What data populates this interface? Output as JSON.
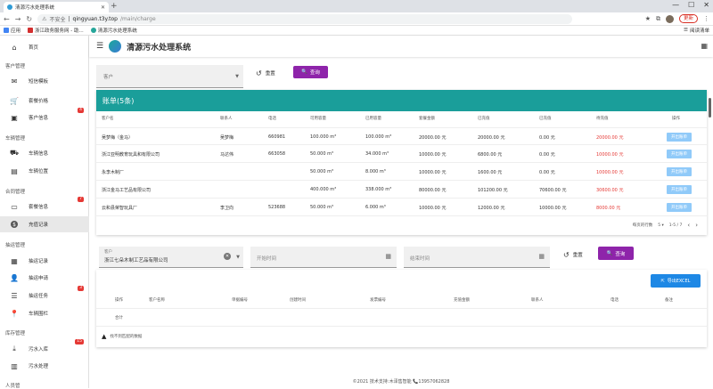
{
  "browser": {
    "tab_title": "清源污水处理系统",
    "url_warning": "不安全",
    "url_host": "qingyuan.t3y.top",
    "url_path": "/main/charge",
    "update_label": "更新",
    "bookmarks": [
      "应用",
      "浙江政务服务网 - 助...",
      "清源污水处理系统"
    ],
    "bookmarks_right": "阅读清单"
  },
  "app": {
    "title": "清源污水处理系统"
  },
  "sidebar": {
    "home": "首页",
    "sections": [
      {
        "title": "客户管理",
        "items": [
          {
            "label": "短信模板",
            "icon": "mail-icon"
          },
          {
            "label": "套餐价格",
            "icon": "cart-icon"
          },
          {
            "label": "客户信息",
            "icon": "contact-icon",
            "badge": "4"
          }
        ]
      },
      {
        "title": "车辆管理",
        "items": [
          {
            "label": "车辆信息",
            "icon": "truck-icon"
          },
          {
            "label": "车辆位置",
            "icon": "map-icon"
          }
        ]
      },
      {
        "title": "合同管理",
        "items": [
          {
            "label": "套餐信息",
            "icon": "wallet-icon",
            "badge": "7"
          },
          {
            "label": "充值记录",
            "icon": "dollar-icon",
            "active": true
          }
        ]
      },
      {
        "title": "抽运管理",
        "items": [
          {
            "label": "抽运记录",
            "icon": "doc-icon"
          },
          {
            "label": "抽运申请",
            "icon": "user-add-icon"
          },
          {
            "label": "抽运任务",
            "icon": "task-icon",
            "badge": "3"
          },
          {
            "label": "车辆围栏",
            "icon": "pin-icon"
          }
        ]
      },
      {
        "title": "库存管理",
        "items": [
          {
            "label": "污水入库",
            "icon": "download-icon",
            "badge": "15"
          },
          {
            "label": "污水处理",
            "icon": "filter-icon"
          }
        ]
      },
      {
        "title": "人员管",
        "items": []
      }
    ]
  },
  "filter1": {
    "customer_placeholder": "客户",
    "reset": "重置",
    "search": "查询"
  },
  "bills": {
    "title": "账单(5条)",
    "columns": [
      "客户名",
      "联系人",
      "电话",
      "可用容量",
      "已用容量",
      "套餐金额",
      "已充值",
      "已充值",
      "待充值",
      "操作"
    ],
    "rows": [
      [
        "吴梦梅（金马）",
        "吴梦梅",
        "660981",
        "100.000 m³",
        "100.000 m³",
        "20000.00 元",
        "20000.00 元",
        "0.00 元",
        "20000.00 元"
      ],
      [
        "浙江亚明教育玩具和有限公司",
        "马达伟",
        "663058",
        "50.000 m³",
        "34.000 m³",
        "10000.00 元",
        "6800.00 元",
        "0.00 元",
        "10000.00 元"
      ],
      [
        "永李木制厂",
        "",
        "",
        "50.000 m³",
        "8.000 m³",
        "10000.00 元",
        "1600.00 元",
        "0.00 元",
        "10000.00 元"
      ],
      [
        "浙江金马工艺品有限公司",
        "",
        "",
        "400.000 m³",
        "338.000 m³",
        "80000.00 元",
        "101200.00 元",
        "70600.00 元",
        "30600.00 元"
      ],
      [
        "云和县荣智玩具厂",
        "李卫向",
        "523688",
        "50.000 m³",
        "6.000 m³",
        "10000.00 元",
        "12000.00 元",
        "10000.00 元",
        "8000.00 元"
      ]
    ],
    "bill_button": "开出账单",
    "pager": {
      "rows_label": "每页的行数",
      "rows_value": "5",
      "range": "1-5 / 7"
    }
  },
  "filter2": {
    "customer_label": "客户",
    "customer_value": "浙江七朵木制工艺品有限公司",
    "start_placeholder": "开始时间",
    "end_placeholder": "结束时间",
    "reset": "重置",
    "search": "查询"
  },
  "records": {
    "export": "导出EXCEL",
    "columns": [
      "操作",
      "客户名称",
      "单据编号",
      "创建时间",
      "发票编号",
      "充值金额",
      "联系人",
      "电话",
      "备注"
    ],
    "total": "合计",
    "no_data": "找不到匹配的数据"
  },
  "footer": "©2021 技术支持:木泽售智能 📞13957062828"
}
